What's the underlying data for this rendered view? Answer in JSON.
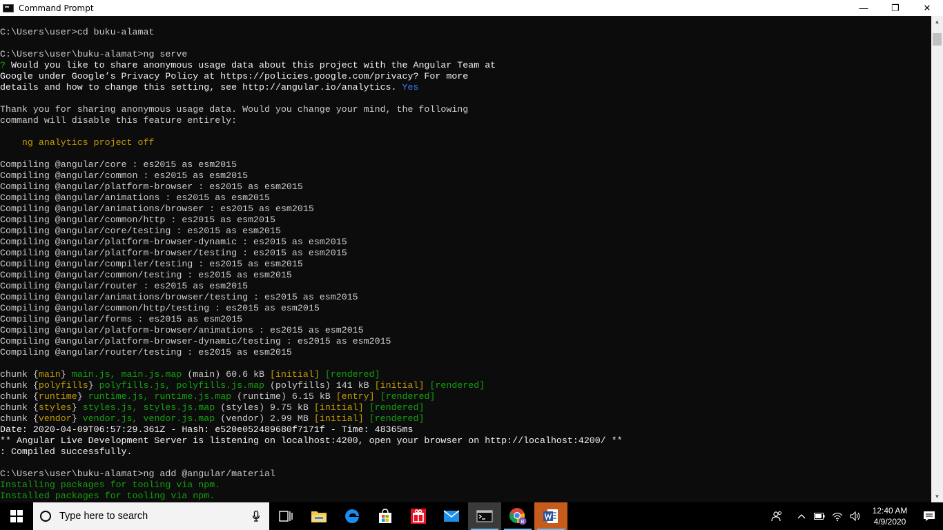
{
  "window": {
    "title": "Command Prompt",
    "minimize_glyph": "—",
    "maximize_glyph": "❐",
    "close_glyph": "✕"
  },
  "console": {
    "lines": [
      [],
      [
        {
          "t": "C:\\Users\\user>cd buku-alamat",
          "c": "default"
        }
      ],
      [],
      [
        {
          "t": "C:\\Users\\user\\buku-alamat>ng serve",
          "c": "default"
        }
      ],
      [
        {
          "t": "?",
          "c": "green"
        },
        {
          "t": " Would you like to share anonymous usage data about this project with the Angular Team at",
          "c": "white"
        }
      ],
      [
        {
          "t": "Google under Google’s Privacy Policy at https://policies.google.com/privacy? For more",
          "c": "white"
        }
      ],
      [
        {
          "t": "details and how to change this setting, see http://angular.io/analytics. ",
          "c": "white"
        },
        {
          "t": "Yes",
          "c": "blue"
        }
      ],
      [],
      [
        {
          "t": "Thank you for sharing anonymous usage data. Would you change your mind, the following",
          "c": "default"
        }
      ],
      [
        {
          "t": "command will disable this feature entirely:",
          "c": "default"
        }
      ],
      [],
      [
        {
          "t": "    ng analytics project off",
          "c": "yellow"
        }
      ],
      [],
      [
        {
          "t": "Compiling @angular/core : es2015 as esm2015",
          "c": "default"
        }
      ],
      [
        {
          "t": "Compiling @angular/common : es2015 as esm2015",
          "c": "default"
        }
      ],
      [
        {
          "t": "Compiling @angular/platform-browser : es2015 as esm2015",
          "c": "default"
        }
      ],
      [
        {
          "t": "Compiling @angular/animations : es2015 as esm2015",
          "c": "default"
        }
      ],
      [
        {
          "t": "Compiling @angular/animations/browser : es2015 as esm2015",
          "c": "default"
        }
      ],
      [
        {
          "t": "Compiling @angular/common/http : es2015 as esm2015",
          "c": "default"
        }
      ],
      [
        {
          "t": "Compiling @angular/core/testing : es2015 as esm2015",
          "c": "default"
        }
      ],
      [
        {
          "t": "Compiling @angular/platform-browser-dynamic : es2015 as esm2015",
          "c": "default"
        }
      ],
      [
        {
          "t": "Compiling @angular/platform-browser/testing : es2015 as esm2015",
          "c": "default"
        }
      ],
      [
        {
          "t": "Compiling @angular/compiler/testing : es2015 as esm2015",
          "c": "default"
        }
      ],
      [
        {
          "t": "Compiling @angular/common/testing : es2015 as esm2015",
          "c": "default"
        }
      ],
      [
        {
          "t": "Compiling @angular/router : es2015 as esm2015",
          "c": "default"
        }
      ],
      [
        {
          "t": "Compiling @angular/animations/browser/testing : es2015 as esm2015",
          "c": "default"
        }
      ],
      [
        {
          "t": "Compiling @angular/common/http/testing : es2015 as esm2015",
          "c": "default"
        }
      ],
      [
        {
          "t": "Compiling @angular/forms : es2015 as esm2015",
          "c": "default"
        }
      ],
      [
        {
          "t": "Compiling @angular/platform-browser/animations : es2015 as esm2015",
          "c": "default"
        }
      ],
      [
        {
          "t": "Compiling @angular/platform-browser-dynamic/testing : es2015 as esm2015",
          "c": "default"
        }
      ],
      [
        {
          "t": "Compiling @angular/router/testing : es2015 as esm2015",
          "c": "default"
        }
      ],
      [],
      [
        {
          "t": "chunk {",
          "c": "default"
        },
        {
          "t": "main",
          "c": "yellow"
        },
        {
          "t": "} ",
          "c": "default"
        },
        {
          "t": "main.js, main.js.map",
          "c": "green"
        },
        {
          "t": " (main) 60.6 kB ",
          "c": "default"
        },
        {
          "t": "[initial]",
          "c": "yellow"
        },
        {
          "t": " ",
          "c": "default"
        },
        {
          "t": "[rendered]",
          "c": "green"
        }
      ],
      [
        {
          "t": "chunk {",
          "c": "default"
        },
        {
          "t": "polyfills",
          "c": "yellow"
        },
        {
          "t": "} ",
          "c": "default"
        },
        {
          "t": "polyfills.js, polyfills.js.map",
          "c": "green"
        },
        {
          "t": " (polyfills) 141 kB ",
          "c": "default"
        },
        {
          "t": "[initial]",
          "c": "yellow"
        },
        {
          "t": " ",
          "c": "default"
        },
        {
          "t": "[rendered]",
          "c": "green"
        }
      ],
      [
        {
          "t": "chunk {",
          "c": "default"
        },
        {
          "t": "runtime",
          "c": "yellow"
        },
        {
          "t": "} ",
          "c": "default"
        },
        {
          "t": "runtime.js, runtime.js.map",
          "c": "green"
        },
        {
          "t": " (runtime) 6.15 kB ",
          "c": "default"
        },
        {
          "t": "[entry]",
          "c": "yellow"
        },
        {
          "t": " ",
          "c": "default"
        },
        {
          "t": "[rendered]",
          "c": "green"
        }
      ],
      [
        {
          "t": "chunk {",
          "c": "default"
        },
        {
          "t": "styles",
          "c": "yellow"
        },
        {
          "t": "} ",
          "c": "default"
        },
        {
          "t": "styles.js, styles.js.map",
          "c": "green"
        },
        {
          "t": " (styles) 9.75 kB ",
          "c": "default"
        },
        {
          "t": "[initial]",
          "c": "yellow"
        },
        {
          "t": " ",
          "c": "default"
        },
        {
          "t": "[rendered]",
          "c": "green"
        }
      ],
      [
        {
          "t": "chunk {",
          "c": "default"
        },
        {
          "t": "vendor",
          "c": "yellow"
        },
        {
          "t": "} ",
          "c": "default"
        },
        {
          "t": "vendor.js, vendor.js.map",
          "c": "green"
        },
        {
          "t": " (vendor) 2.99 MB ",
          "c": "default"
        },
        {
          "t": "[initial]",
          "c": "yellow"
        },
        {
          "t": " ",
          "c": "default"
        },
        {
          "t": "[rendered]",
          "c": "green"
        }
      ],
      [
        {
          "t": "Date: 2020-04-09T06:57:29.361Z - Hash: e520e052489680f7171f - Time: 48365ms",
          "c": "white"
        }
      ],
      [
        {
          "t": "** Angular Live Development Server is listening on localhost:4200, open your browser on http://localhost:4200/ **",
          "c": "white"
        }
      ],
      [
        {
          "t": ": Compiled successfully.",
          "c": "white"
        }
      ],
      [],
      [
        {
          "t": "C:\\Users\\user\\buku-alamat>ng add @angular/material",
          "c": "default"
        }
      ],
      [
        {
          "t": "Installing packages for tooling via npm.",
          "c": "green"
        }
      ],
      [
        {
          "t": "Installed packages for tooling via npm.",
          "c": "green"
        }
      ]
    ]
  },
  "scrollbar": {
    "up_glyph": "▲",
    "down_glyph": "▼"
  },
  "taskbar": {
    "search_placeholder": "Type here to search",
    "apps": [
      {
        "name": "task-view-icon",
        "state": ""
      },
      {
        "name": "file-explorer-icon",
        "state": ""
      },
      {
        "name": "edge-icon",
        "state": ""
      },
      {
        "name": "store-icon",
        "state": ""
      },
      {
        "name": "gift-app-icon",
        "state": ""
      },
      {
        "name": "mail-icon",
        "state": ""
      },
      {
        "name": "command-prompt-taskbar-icon",
        "state": "active"
      },
      {
        "name": "chrome-icon",
        "state": "open"
      },
      {
        "name": "word-icon",
        "state": "open"
      }
    ],
    "clock_time": "12:40 AM",
    "clock_date": "4/9/2020",
    "chrome_badge": "B"
  },
  "colors": {
    "console_bg": "#0c0c0c",
    "console_text": "#cccccc",
    "green": "#13a10e",
    "yellow": "#c19c00",
    "blue": "#3b78ff",
    "taskbar_bg": "#000000"
  }
}
